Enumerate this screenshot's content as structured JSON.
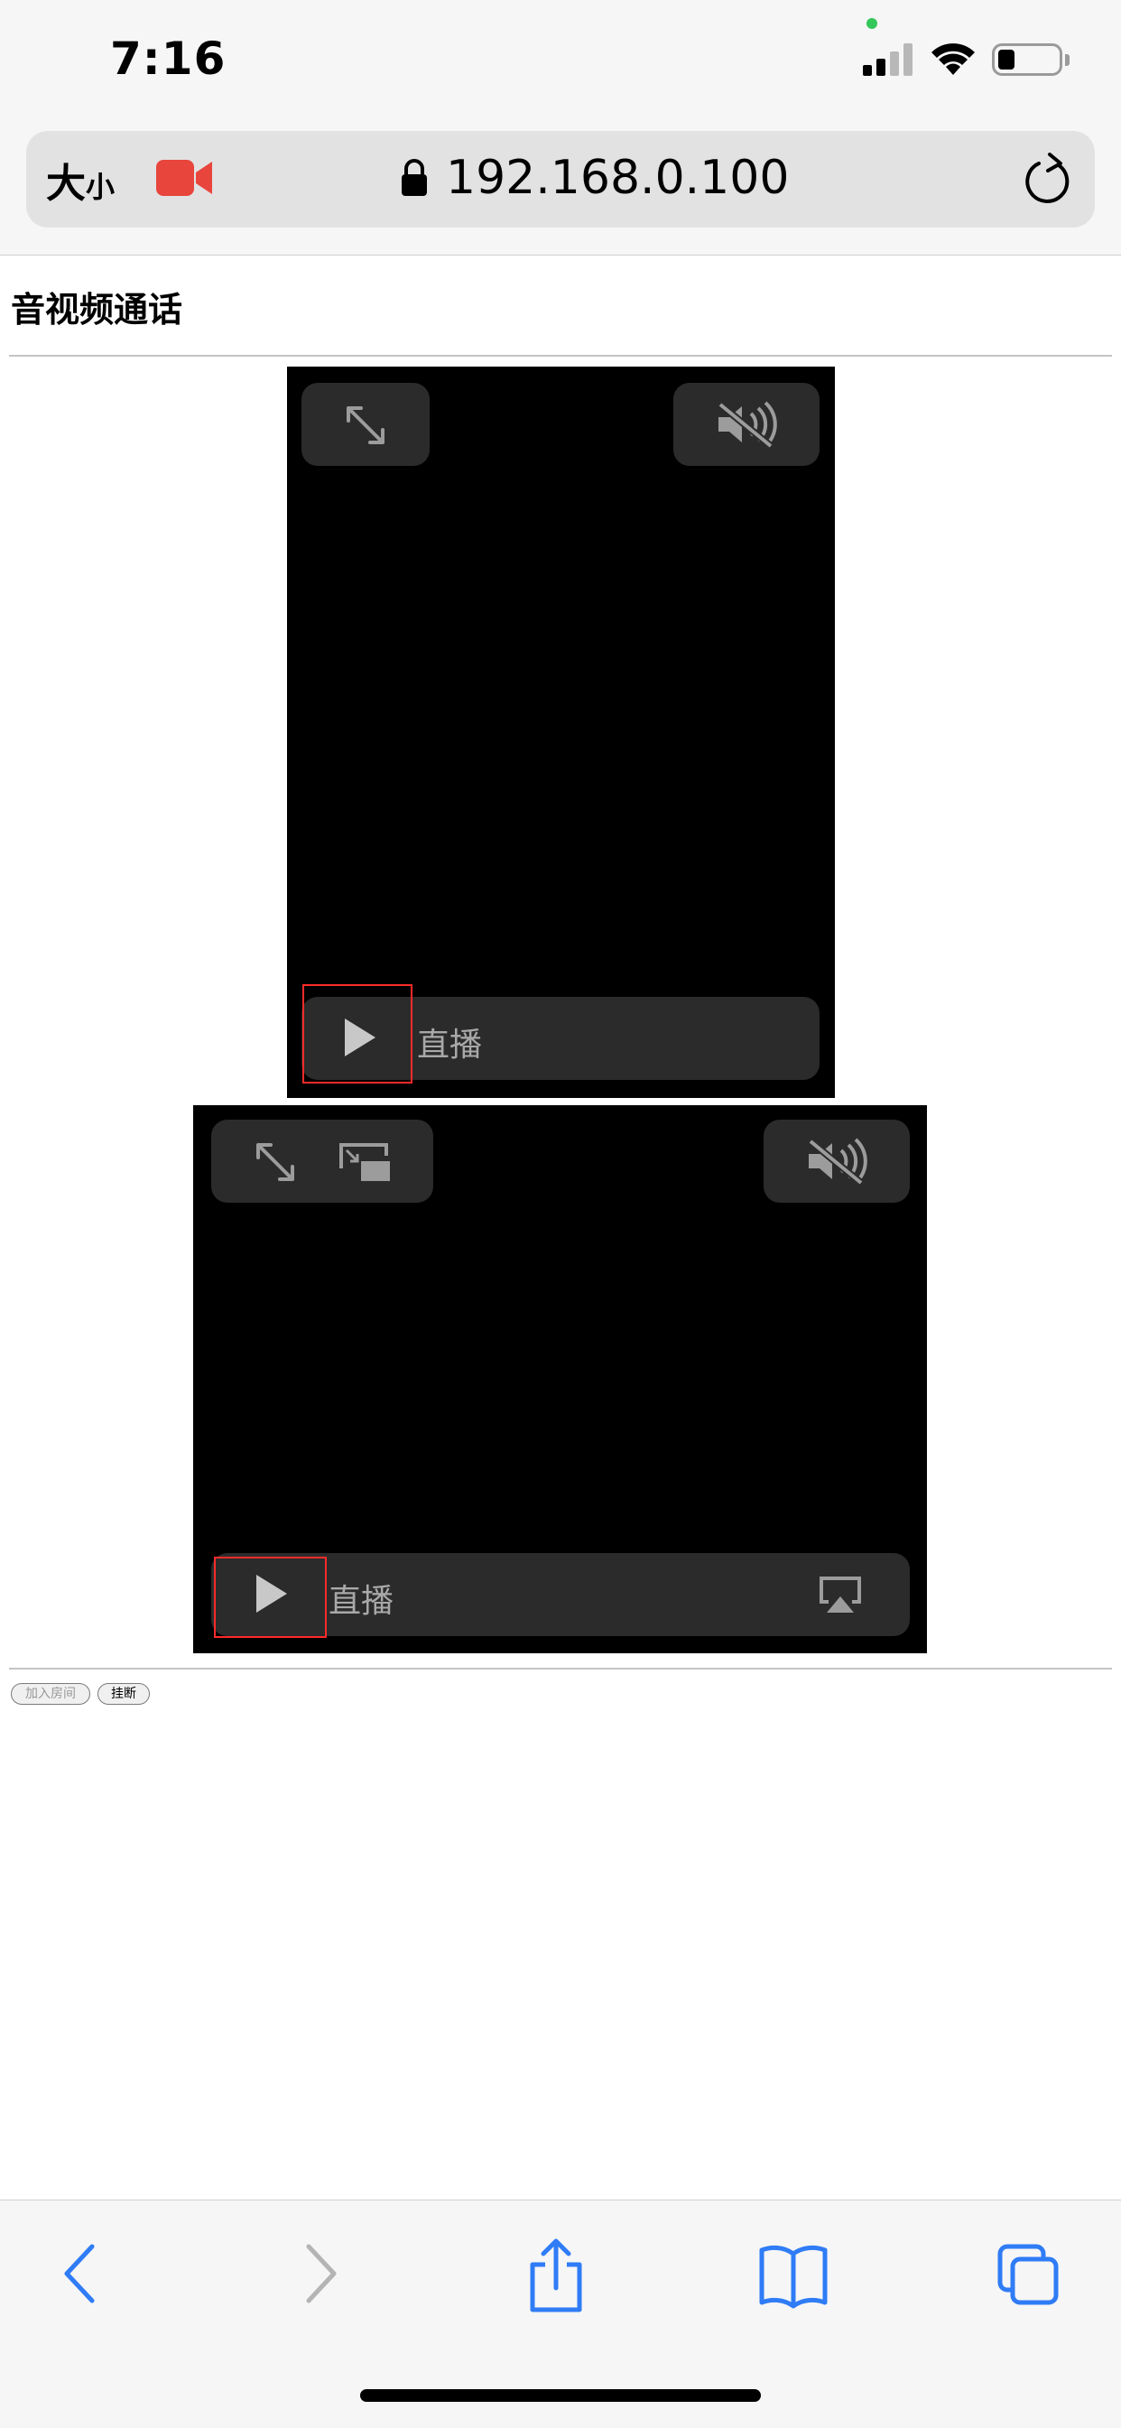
{
  "status_bar": {
    "time": "7:16",
    "signal_bars": 4,
    "signal_bars_active": 2,
    "battery_percent": 25,
    "privacy_dot_color": "#34c759"
  },
  "address_bar": {
    "text_size_big": "大",
    "text_size_small": "小",
    "camera_icon": "video-camera-icon",
    "camera_color": "#e8453c",
    "lock_icon": "lock-icon",
    "url": "192.168.0.100",
    "reload_icon": "reload-icon"
  },
  "page": {
    "title": "音视频通话",
    "videos": [
      {
        "live_label": "直播",
        "controls": [
          "fullscreen-icon",
          "mute-icon",
          "play-icon"
        ]
      },
      {
        "live_label": "直播",
        "controls": [
          "fullscreen-icon",
          "picture-in-picture-icon",
          "mute-icon",
          "play-icon",
          "airplay-icon"
        ]
      }
    ],
    "buttons": {
      "join_room": "加入房间",
      "hang_up": "挂断"
    }
  },
  "toolbar": {
    "items": [
      "back-icon",
      "forward-icon",
      "share-icon",
      "bookmarks-icon",
      "tabs-icon"
    ],
    "accent_color": "#2f7cf6",
    "disabled_color": "#b4b4b4"
  }
}
